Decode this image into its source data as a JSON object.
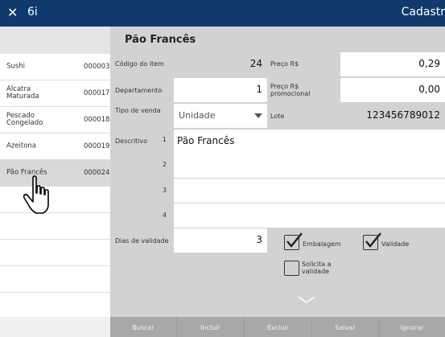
{
  "titlebar": {
    "close_glyph": "✕",
    "title": "6i",
    "right_title": "Cadastr"
  },
  "sidebar": {
    "items": [
      {
        "name": "Sushi",
        "code": "000003",
        "selected": false
      },
      {
        "name": "Alcatra Maturada",
        "code": "000017",
        "selected": false
      },
      {
        "name": "Pescado Congelado",
        "code": "000018",
        "selected": false
      },
      {
        "name": "Azeitona",
        "code": "000019",
        "selected": false
      },
      {
        "name": "Pão Francês",
        "code": "000024",
        "selected": true
      }
    ]
  },
  "form": {
    "title": "Pão Francês",
    "codigo_label": "Código do item",
    "codigo_value": "24",
    "preco_label": "Preço R$",
    "preco_value": "0,29",
    "departamento_label": "Departamento",
    "departamento_value": "1",
    "preco_promo_label": "Preço R$ promocional",
    "preco_promo_value": "0,00",
    "tipo_venda_label": "Tipo de venda",
    "tipo_venda_value": "Unidade",
    "lote_label": "Lote",
    "lote_value": "123456789012",
    "descritivo_label": "Descritivo",
    "descritivo_lines": [
      {
        "num": "1",
        "value": "Pão Francês"
      },
      {
        "num": "2",
        "value": ""
      },
      {
        "num": "3",
        "value": ""
      },
      {
        "num": "4",
        "value": ""
      }
    ],
    "dias_validade_label": "Dias de validade",
    "dias_validade_value": "3",
    "embalagem_label": "Embalagem",
    "embalagem_checked": true,
    "validade_label": "Validade",
    "validade_checked": true,
    "solicita_label": "Solicita a validade",
    "solicita_checked": false
  },
  "buttons": {
    "buscar": "Buscar",
    "incluir": "Incluir",
    "excluir": "Excluir",
    "salvar": "Salvar",
    "ignorar": "Ignorar"
  },
  "colors": {
    "titlebar": "#0f3a6b",
    "panel": "#d2d2d2",
    "bottombar": "#a8a8a8",
    "selected_row": "#d9d9d9"
  },
  "icons": {
    "close": "close-icon",
    "pointer": "hand-pointer-icon",
    "expand": "chevron-down-icon",
    "check": "checkmark-icon"
  }
}
